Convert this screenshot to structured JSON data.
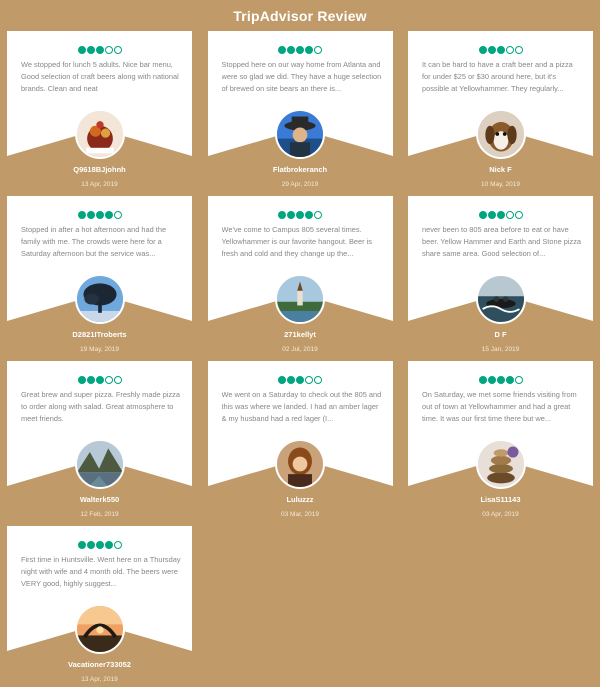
{
  "header": {
    "title": "TripAdvisor Review"
  },
  "colors": {
    "background": "#c09a68",
    "card": "#ffffff",
    "star_fill": "#00a680",
    "text_muted": "#888888"
  },
  "reviews": [
    {
      "rating": 3,
      "text": "We stopped for lunch 5 adults. Nice bar menu, Good selection of craft beers along with national brands. Clean and neat",
      "author": "Q9618BJjohnh",
      "date": "13 Apr, 2019",
      "avatar_icon": "dessert-photo-icon"
    },
    {
      "rating": 4,
      "text": "Stopped here on our way home from Atlanta and were so glad we did. They have a huge selection of brewed on site bears an there is...",
      "author": "Flatbrokeranch",
      "date": "29 Apr, 2019",
      "avatar_icon": "cowboy-photo-icon"
    },
    {
      "rating": 3,
      "text": "It can be hard to have a craft beer and a pizza for under $25 or $30 around here, but it's possible at Yellowhammer. They regularly...",
      "author": "Nick F",
      "date": "10 May, 2019",
      "avatar_icon": "dog-photo-icon"
    },
    {
      "rating": 4,
      "text": "Stopped in after a hot afternoon and had the family with me. The crowds were here for a Saturday afternoon but the service was...",
      "author": "D2821ITroberts",
      "date": "19 May, 2019",
      "avatar_icon": "tree-sky-photo-icon"
    },
    {
      "rating": 4,
      "text": "We've come to Campus 805 several times. Yellowhammer is our favorite hangout. Beer is fresh and cold and they change up the...",
      "author": "271kellyt",
      "date": "02 Jul, 2019",
      "avatar_icon": "church-lake-photo-icon"
    },
    {
      "rating": 3,
      "text": "never been to 805 area before to eat or have beer. Yellow Hammer and Earth and Stone pizza share same area. Good selection of...",
      "author": "D F",
      "date": "15 Jan, 2019",
      "avatar_icon": "rafting-photo-icon"
    },
    {
      "rating": 3,
      "text": "Great brew and super pizza. Freshly made pizza to order along with salad. Great atmosphere to meet friends.",
      "author": "Walterk550",
      "date": "12 Feb, 2019",
      "avatar_icon": "mountain-lake-photo-icon"
    },
    {
      "rating": 3,
      "text": "We went on a Saturday to check out the 805 and this was where we landed. I had an amber lager & my husband had a red lager (I...",
      "author": "Luluzzz",
      "date": "03 Mar, 2019",
      "avatar_icon": "woman-portrait-photo-icon"
    },
    {
      "rating": 4,
      "text": "On Saturday, we met some friends visiting from out of town at Yellowhammer and had a great time. It was our first time there but we...",
      "author": "LisaS11143",
      "date": "03 Apr, 2019",
      "avatar_icon": "stacked-stones-photo-icon"
    },
    {
      "rating": 4,
      "text": "First time in Huntsville. Went here on a Thursday night with wife and 4 month old. The beers were VERY good, highly suggest...",
      "author": "Vacationer733052",
      "date": "13 Apr, 2019",
      "avatar_icon": "sunset-arch-photo-icon"
    }
  ]
}
